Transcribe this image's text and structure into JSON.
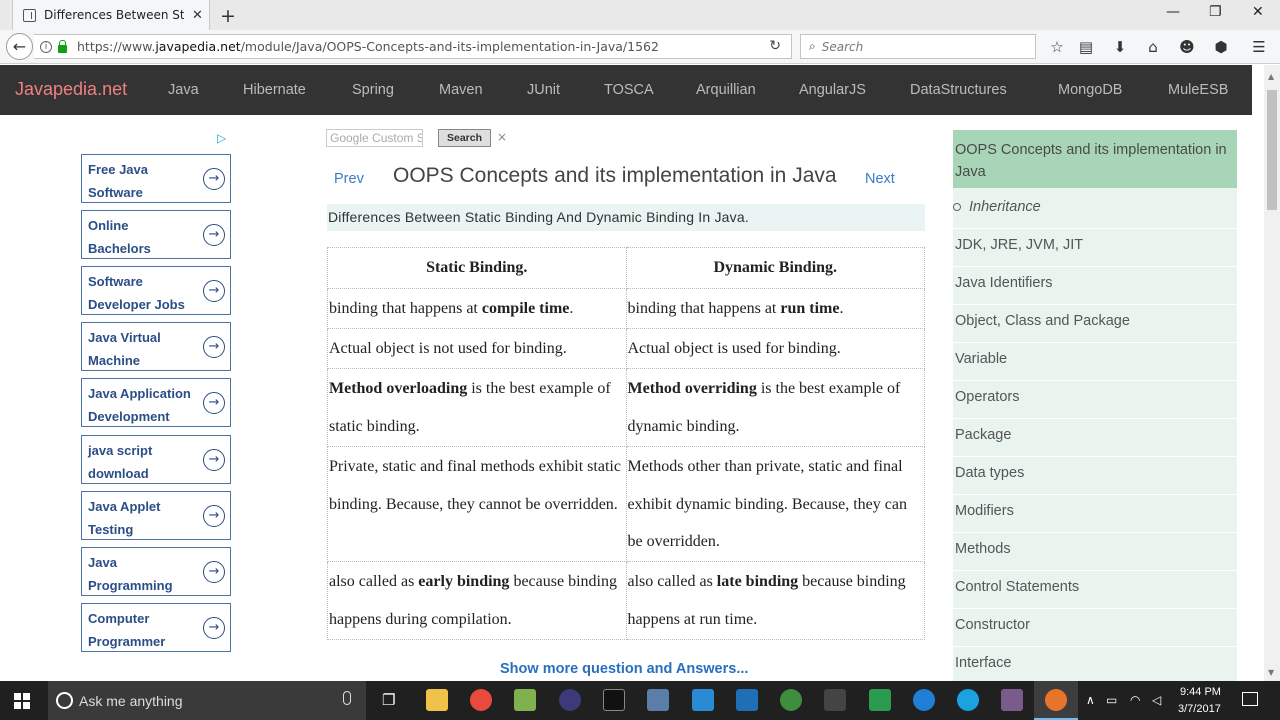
{
  "browser": {
    "tab_title": "Differences Between Static...",
    "tab_close": "✕",
    "new_tab": "+",
    "url_prefix": "https://www.",
    "url_domain": "javapedia.net",
    "url_path": "/module/Java/OOPS-Concepts-and-its-implementation-in-Java/1562",
    "search_placeholder": "Search"
  },
  "site": {
    "brand": "Javapedia.net",
    "nav": [
      "Java",
      "Hibernate",
      "Spring",
      "Maven",
      "JUnit",
      "TOSCA",
      "Arquillian",
      "AngularJS",
      "DataStructures",
      "MongoDB",
      "MuleESB"
    ]
  },
  "ads": [
    {
      "line1": "Free Java",
      "line2": "Software"
    },
    {
      "line1": "Online",
      "line2": "Bachelors"
    },
    {
      "line1": "Software",
      "line2": "Developer Jobs"
    },
    {
      "line1": "Java Virtual",
      "line2": "Machine"
    },
    {
      "line1": "Java Application",
      "line2": "Development"
    },
    {
      "line1": "java script",
      "line2": "download"
    },
    {
      "line1": "Java Applet",
      "line2": "Testing"
    },
    {
      "line1": "Java",
      "line2": "Programming"
    },
    {
      "line1": "Computer",
      "line2": "Programmer"
    }
  ],
  "google_search": {
    "brand": "Google",
    "placeholder": "Custom Search",
    "button": "Search",
    "clear": "×"
  },
  "main": {
    "prev": "Prev",
    "title": "OOPS Concepts and its implementation in Java",
    "next": "Next",
    "subheading": "Differences Between Static Binding And Dynamic Binding In Java.",
    "table": {
      "headers": [
        "Static Binding.",
        "Dynamic Binding."
      ],
      "rows": [
        [
          {
            "pre": "binding that happens at ",
            "bold": "compile time",
            "post": "."
          },
          {
            "pre": "binding that happens at ",
            "bold": "run time",
            "post": "."
          }
        ],
        [
          {
            "pre": "Actual object is not used for binding.",
            "bold": "",
            "post": ""
          },
          {
            "pre": "Actual object is used for binding.",
            "bold": "",
            "post": ""
          }
        ],
        [
          {
            "pre": "",
            "bold": "Method overloading",
            "post": " is the best example of static binding."
          },
          {
            "pre": "",
            "bold": "Method overriding",
            "post": " is the best example of dynamic binding."
          }
        ],
        [
          {
            "pre": "Private, static and final methods exhibit static binding. Because, they cannot be overridden.",
            "bold": "",
            "post": ""
          },
          {
            "pre": "Methods other than private, static and final exhibit dynamic binding. Because, they can be overridden.",
            "bold": "",
            "post": ""
          }
        ],
        [
          {
            "pre": "also called as ",
            "bold": "early binding",
            "post": " because binding happens during compilation."
          },
          {
            "pre": "also called as ",
            "bold": "late binding",
            "post": " because binding happens at run time."
          }
        ]
      ]
    },
    "show_more": "Show more question and Answers..."
  },
  "sidebar": {
    "active": "OOPS Concepts and its implementation in Java",
    "sub_item": "Inheritance",
    "items": [
      "JDK, JRE, JVM, JIT",
      "Java Identifiers",
      "Object, Class and Package",
      "Variable",
      "Operators",
      "Package",
      "Data types",
      "Modifiers",
      "Methods",
      "Control Statements",
      "Constructor",
      "Interface"
    ]
  },
  "taskbar": {
    "search_text": "Ask me anything",
    "time": "9:44 PM",
    "date": "3/7/2017"
  }
}
